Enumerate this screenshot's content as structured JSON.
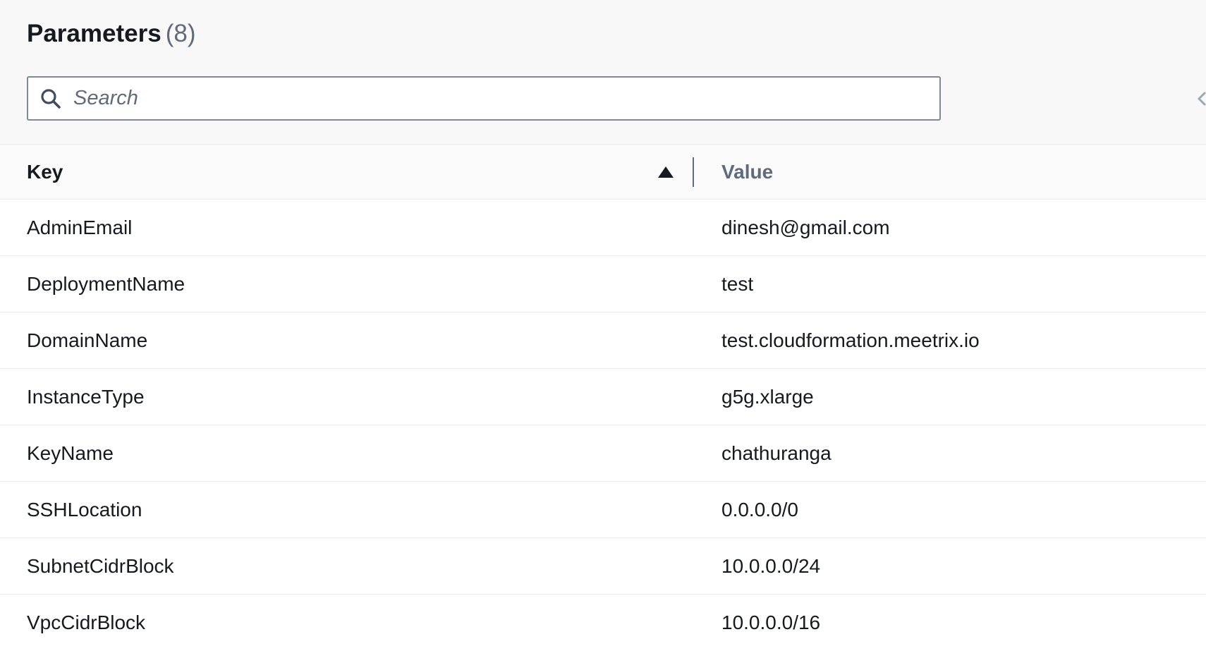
{
  "header": {
    "title": "Parameters",
    "count": "(8)"
  },
  "search": {
    "placeholder": "Search",
    "value": ""
  },
  "icons": {
    "search": "search-icon",
    "sort": "sort-ascending-icon",
    "pager_prev": "chevron-left-icon"
  },
  "colors": {
    "text": "#16191f",
    "muted": "#5f6b7a",
    "border": "#7d8998",
    "header_bg": "#f8f8f8"
  },
  "table": {
    "columns": {
      "key": "Key",
      "value": "Value"
    },
    "sort": "ascending",
    "rows": [
      {
        "key": "AdminEmail",
        "value": "dinesh@gmail.com"
      },
      {
        "key": "DeploymentName",
        "value": "test"
      },
      {
        "key": "DomainName",
        "value": "test.cloudformation.meetrix.io"
      },
      {
        "key": "InstanceType",
        "value": "g5g.xlarge"
      },
      {
        "key": "KeyName",
        "value": "chathuranga"
      },
      {
        "key": "SSHLocation",
        "value": "0.0.0.0/0"
      },
      {
        "key": "SubnetCidrBlock",
        "value": "10.0.0.0/24"
      },
      {
        "key": "VpcCidrBlock",
        "value": "10.0.0.0/16"
      }
    ]
  }
}
